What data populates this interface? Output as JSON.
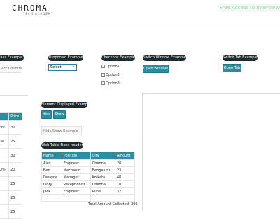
{
  "header": {
    "logo_main": "CHROMA",
    "logo_sub": "TECH ACADEMY",
    "free_access": "Free Access to InterviewQ"
  },
  "sections": {
    "class_example": {
      "title": "Class Example",
      "placeholder": "lect Countries"
    },
    "dropdown_example": {
      "title": "Dropdown Example",
      "selected": "Select"
    },
    "checkbox_example": {
      "title": "Checkbox Example",
      "options": [
        "Option1",
        "Option2",
        "Option3"
      ]
    },
    "switch_window": {
      "title": "Switch Window Example",
      "button": "Open Window"
    },
    "switch_tab": {
      "title": "Switch Tab Example",
      "button": "Open Tab"
    },
    "element_displayed": {
      "title": "Element Displayed Example",
      "hide_button": "Hide",
      "show_button": "Show",
      "placeholder": "Hide/Show Example"
    },
    "web_table_fixed": {
      "title": "Web Table Fixed header",
      "columns": [
        "Name",
        "Position",
        "City",
        "Amount"
      ],
      "rows": [
        [
          "Alex",
          "Engineer",
          "Chennai",
          "28"
        ],
        [
          "Ben",
          "Mechanic",
          "Bengaluru",
          "23"
        ],
        [
          "Dwayne",
          "Manager",
          "Kolkata",
          "48"
        ],
        [
          "Ivory",
          "Receptionist",
          "Chennai",
          "18"
        ],
        [
          "Jack",
          "Engineer",
          "Pune",
          "32"
        ]
      ],
      "total_text": "Total Amount Collected: 296"
    },
    "left_table": {
      "columns": [
        "",
        "Price"
      ],
      "rows": [
        [
          "ors",
          "30"
        ],
        [
          "ise",
          "25"
        ],
        [
          "",
          "30"
        ],
        [
          "urs-",
          "20"
        ],
        [
          "",
          "25"
        ],
        [
          "",
          "25"
        ],
        [
          "",
          "25"
        ]
      ]
    }
  }
}
